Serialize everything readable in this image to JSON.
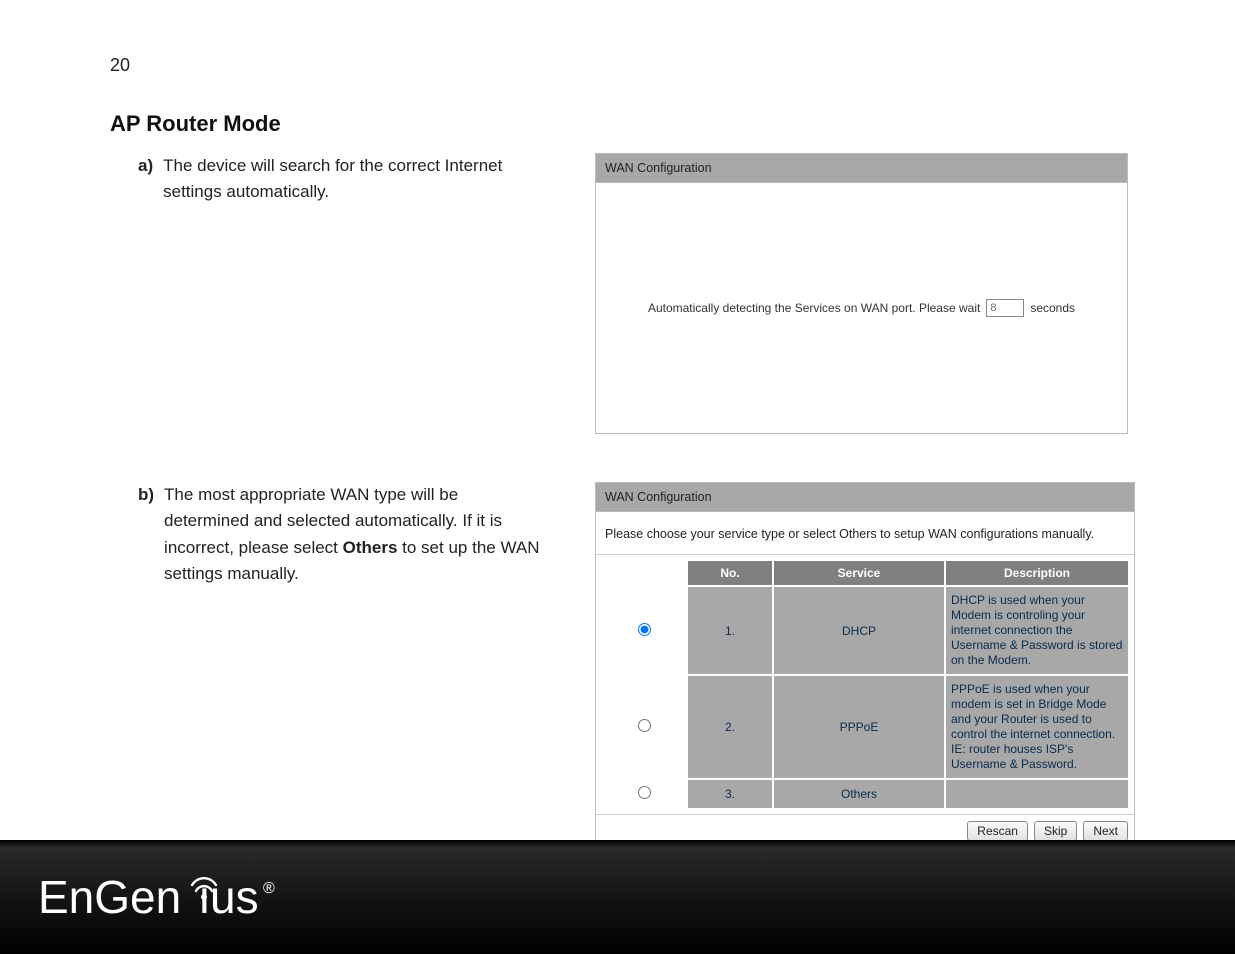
{
  "page_number": "20",
  "heading": "AP Router Mode",
  "item_a": {
    "marker": "a)",
    "text": "The device will search for the correct Internet settings automatically."
  },
  "item_b": {
    "marker": "b)",
    "text_pre": "The most appropriate WAN type will be determined and selected automatically. If it is incorrect, please select ",
    "bold": "Others",
    "text_post": " to set up the WAN settings manually."
  },
  "panel_a": {
    "title": "WAN Configuration",
    "msg_pre": "Automatically detecting the Services on WAN port. Please wait",
    "value": "8",
    "msg_post": "seconds"
  },
  "panel_b": {
    "title": "WAN Configuration",
    "instruction": "Please choose your service type or select Others to setup WAN configurations manually.",
    "th_no": "No.",
    "th_service": "Service",
    "th_desc": "Description",
    "rows": [
      {
        "no": "1.",
        "service": "DHCP",
        "desc": "DHCP is used when your Modem is controling your internet connection the Username & Password is stored on the Modem.",
        "checked": true
      },
      {
        "no": "2.",
        "service": "PPPoE",
        "desc": "PPPoE is used when your modem is set in Bridge Mode and your Router is used to control the internet connection. IE: router houses ISP's Username & Password.",
        "checked": false
      },
      {
        "no": "3.",
        "service": "Others",
        "desc": "",
        "checked": false
      }
    ],
    "btn_rescan": "Rescan",
    "btn_skip": "Skip",
    "btn_next": "Next"
  },
  "brand": "EnGenius"
}
